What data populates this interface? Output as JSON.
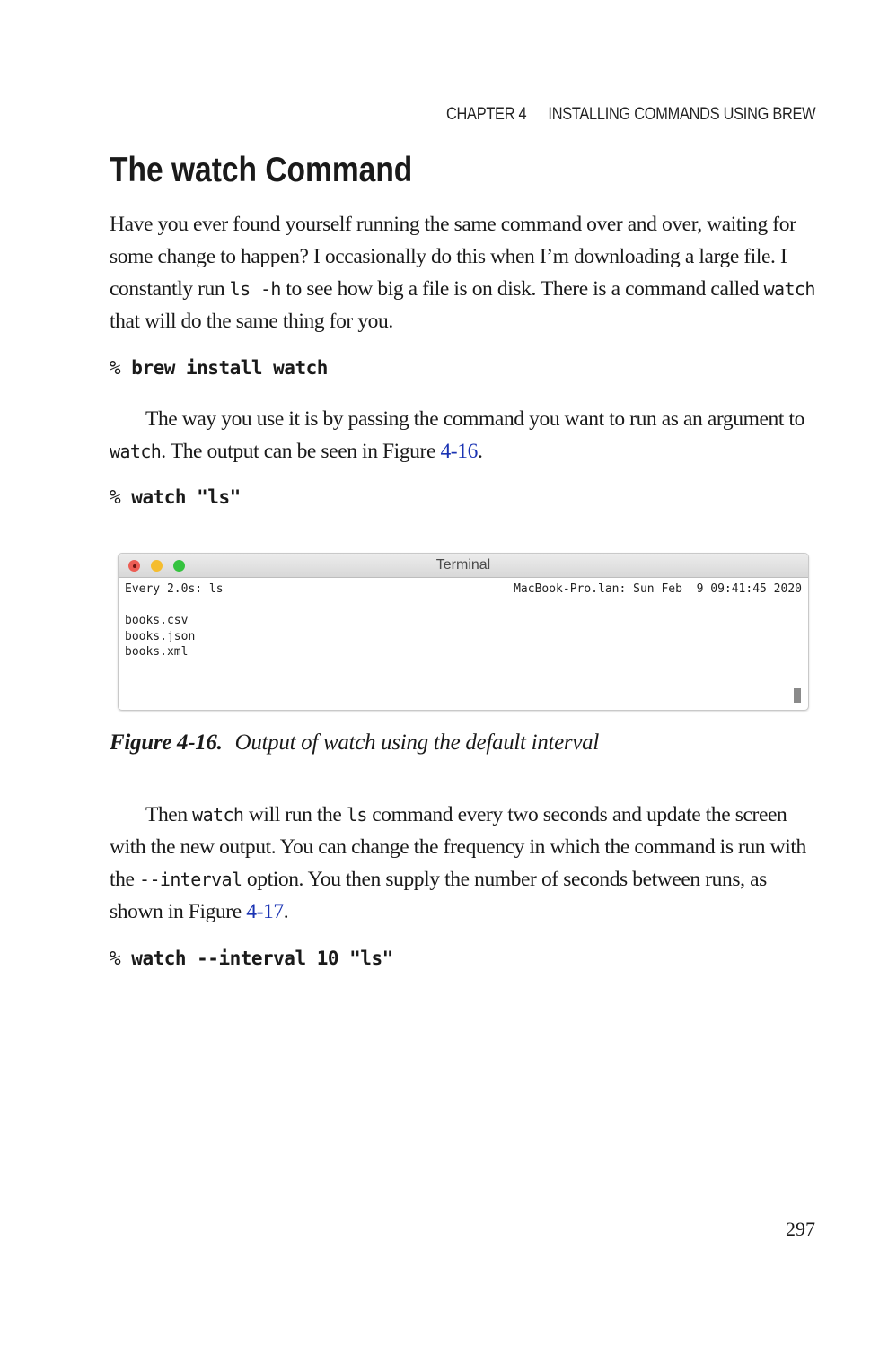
{
  "running_head": {
    "chapter": "CHAPTER 4",
    "title": "INSTALLING COMMANDS USING BREW"
  },
  "section_title": "The watch Command",
  "paragraph1": {
    "t1": "Have you ever found yourself running the same command over and over, waiting for some change to happen? I occasionally do this when I’m downloading a large file. I constantly run ",
    "code1": "ls -h",
    "t2": " to see how big a file is on disk. There is a command called ",
    "code2": "watch",
    "t3": " that will do the same thing for you."
  },
  "code1": {
    "prompt": "% ",
    "command": "brew install watch"
  },
  "paragraph2": {
    "t1": "The way you use it is by passing the command you want to run as an argument to ",
    "code1": "watch",
    "t2": ". The output can be seen in Figure ",
    "link": "4-16",
    "t3": "."
  },
  "code2": {
    "prompt": "% ",
    "command": "watch \"ls\""
  },
  "terminal": {
    "window_title": "Terminal",
    "header_left": "Every 2.0s: ls",
    "header_right": "MacBook-Pro.lan: Sun Feb  9 09:41:45 2020",
    "lines": [
      "books.csv",
      "books.json",
      "books.xml"
    ]
  },
  "caption": {
    "label": "Figure 4-16.",
    "text": "Output of watch using the default interval"
  },
  "paragraph3": {
    "t1": "Then ",
    "code1": "watch",
    "t2": " will run the ",
    "code2": "ls",
    "t3": " command every two seconds and update the screen with the new output. You can change the frequency in which the command is run with the ",
    "code3": "--interval",
    "t4": " option. You then supply the number of seconds between runs, as shown in Figure ",
    "link": "4-17",
    "t5": "."
  },
  "code3": {
    "prompt": "% ",
    "command": "watch --interval 10 \"ls\""
  },
  "page_number": "297"
}
